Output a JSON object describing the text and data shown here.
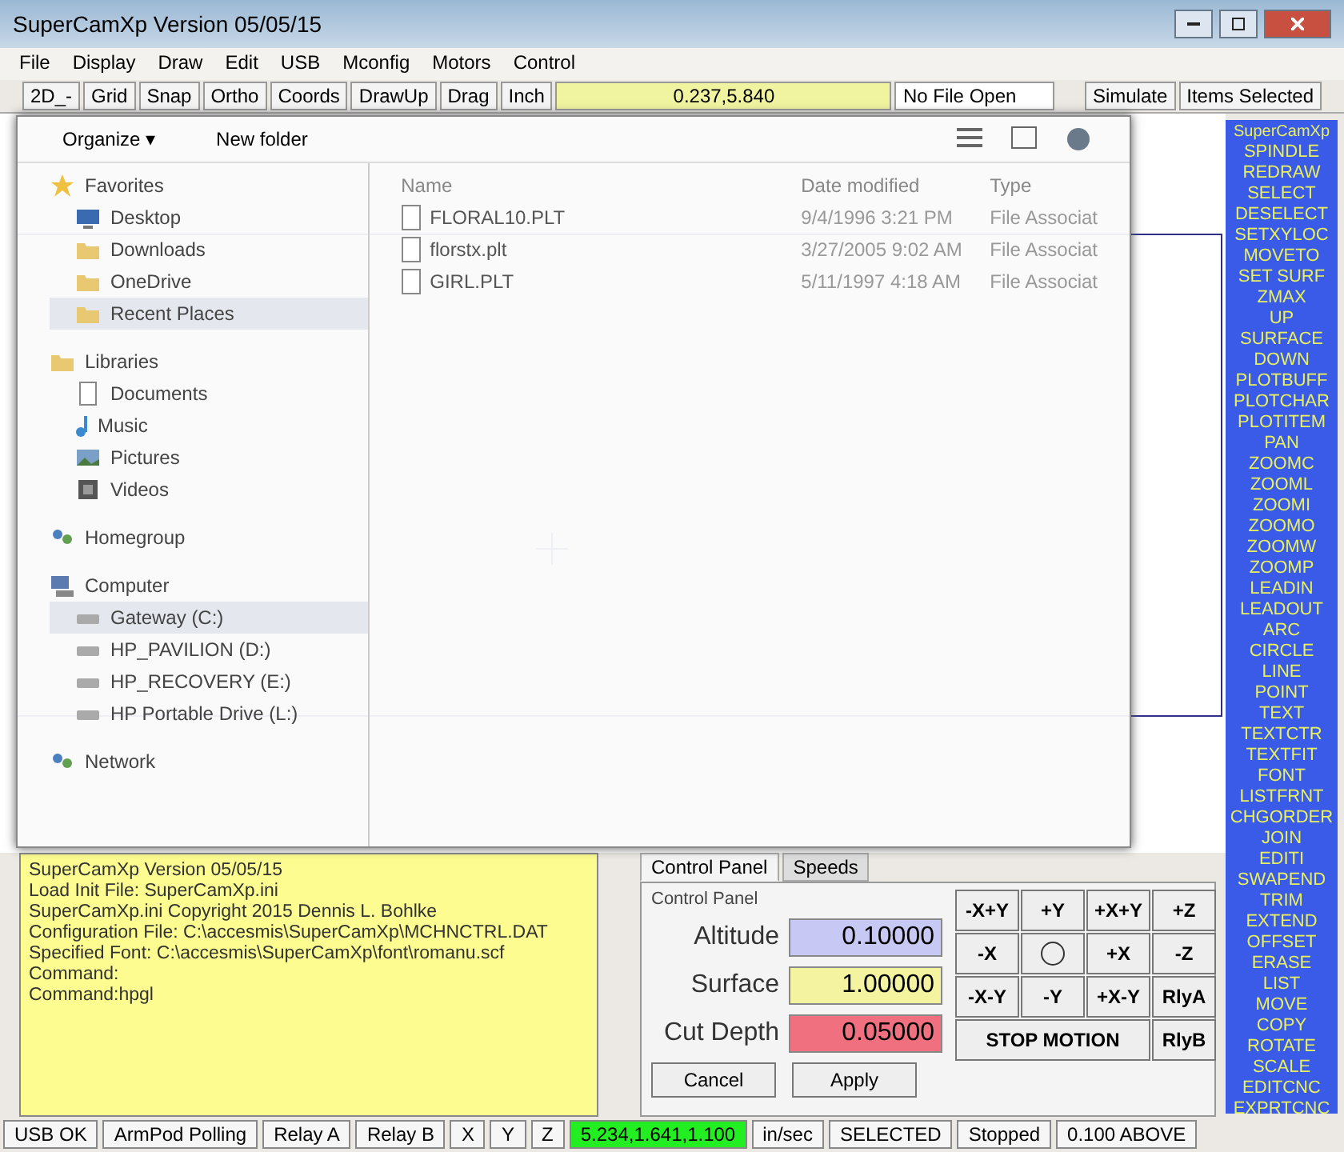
{
  "window": {
    "title": "SuperCamXp Version 05/05/15"
  },
  "menu": [
    "File",
    "Display",
    "Draw",
    "Edit",
    "USB",
    "Mconfig",
    "Motors",
    "Control"
  ],
  "toolbar": [
    {
      "text": "2D_-",
      "kind": "button"
    },
    {
      "text": "Grid",
      "kind": "button"
    },
    {
      "text": "Snap",
      "kind": "button"
    },
    {
      "text": "Ortho",
      "kind": "button"
    },
    {
      "text": "Coords",
      "kind": "button"
    },
    {
      "text": "DrawUp",
      "kind": "button"
    },
    {
      "text": "Drag",
      "kind": "button"
    },
    {
      "text": "Inch",
      "kind": "button"
    },
    {
      "text": "0.237,5.840",
      "kind": "readout"
    },
    {
      "text": "No File Open",
      "kind": "field"
    }
  ],
  "toolbar_right": [
    "Simulate",
    "Items Selected"
  ],
  "dialog": {
    "toolbar": {
      "organize": "Organize ▾",
      "new_folder": "New folder"
    },
    "nav": [
      {
        "label": "Favorites",
        "kind": "star",
        "selected": false,
        "children": [
          {
            "label": "Desktop",
            "kind": "desktop",
            "selected": false
          },
          {
            "label": "Downloads",
            "kind": "folder",
            "selected": false
          },
          {
            "label": "OneDrive",
            "kind": "folder",
            "selected": false
          },
          {
            "label": "Recent Places",
            "kind": "folder",
            "selected": true
          }
        ]
      },
      {
        "label": "Libraries",
        "kind": "folder",
        "selected": false,
        "children": [
          {
            "label": "Documents",
            "kind": "document",
            "selected": false
          },
          {
            "label": "Music",
            "kind": "music",
            "selected": false
          },
          {
            "label": "Pictures",
            "kind": "picture",
            "selected": false
          },
          {
            "label": "Videos",
            "kind": "video",
            "selected": false
          }
        ]
      },
      {
        "label": "Homegroup",
        "kind": "group",
        "selected": false
      },
      {
        "label": "Computer",
        "kind": "computer",
        "selected": false,
        "children": [
          {
            "label": "Gateway (C:)",
            "kind": "drive",
            "selected": true
          },
          {
            "label": "HP_PAVILION (D:)",
            "kind": "drive",
            "selected": false
          },
          {
            "label": "HP_RECOVERY (E:)",
            "kind": "drive",
            "selected": false
          },
          {
            "label": "HP Portable Drive (L:)",
            "kind": "drive",
            "selected": false
          }
        ]
      },
      {
        "label": "Network",
        "kind": "group",
        "selected": false
      }
    ],
    "columns": [
      "Name",
      "Date modified",
      "Type"
    ],
    "files": [
      {
        "name": "FLORAL10.PLT",
        "date": "9/4/1996 3:21 PM",
        "type": "File Associat"
      },
      {
        "name": "florstx.plt",
        "date": "3/27/2005 9:02 AM",
        "type": "File Associat"
      },
      {
        "name": "GIRL.PLT",
        "date": "5/11/1997 4:18 AM",
        "type": "File Associat"
      }
    ]
  },
  "commands": [
    "SuperCamXp",
    "SPINDLE",
    "REDRAW",
    "SELECT",
    "DESELECT",
    "SETXYLOC",
    "MOVETO",
    "SET SURF",
    "ZMAX",
    "UP",
    "SURFACE",
    "DOWN",
    "PLOTBUFF",
    "PLOTCHAR",
    "PLOTITEM",
    "PAN",
    "ZOOMC",
    "ZOOML",
    "ZOOMI",
    "ZOOMO",
    "ZOOMW",
    "ZOOMP",
    "LEADIN",
    "LEADOUT",
    "ARC",
    "CIRCLE",
    "LINE",
    "POINT",
    "TEXT",
    "TEXTCTR",
    "TEXTFIT",
    "FONT",
    "LISTFRNT",
    "CHGORDER",
    "JOIN",
    "EDITI",
    "SWAPEND",
    "TRIM",
    "EXTEND",
    "OFFSET",
    "ERASE",
    "LIST",
    "MOVE",
    "COPY",
    "ROTATE",
    "SCALE",
    "EDITCNC",
    "EXPRTCNC"
  ],
  "console": [
    "SuperCamXp Version 05/05/15",
    "Load Init File: SuperCamXp.ini",
    "SuperCamXp.ini Copyright 2015 Dennis L. Bohlke",
    "Configuration File: C:\\accesmis\\SuperCamXp\\MCHNCTRL.DAT",
    "Specified Font: C:\\accesmis\\SuperCamXp\\font\\romanu.scf",
    "Command:",
    "Command:hpgl"
  ],
  "panel": {
    "tabs": [
      {
        "label": "Control Panel",
        "selected": true
      },
      {
        "label": "Speeds",
        "selected": false
      }
    ],
    "group": "Control Panel",
    "fields": [
      {
        "label": "Altitude",
        "value": "0.10000",
        "color": "#c8c8f4"
      },
      {
        "label": "Surface",
        "value": "1.00000",
        "color": "#f4f4a0"
      },
      {
        "label": "Cut Depth",
        "value": "0.05000",
        "color": "#f07080"
      }
    ],
    "buttons": [
      "Cancel",
      "Apply"
    ],
    "jog": [
      {
        "text": "-X+Y",
        "kind": "key"
      },
      {
        "text": "+Y",
        "kind": "key"
      },
      {
        "text": "+X+Y",
        "kind": "key"
      },
      {
        "text": "+Z",
        "kind": "key"
      },
      {
        "text": "-X",
        "kind": "key"
      },
      {
        "kind": "home"
      },
      {
        "text": "+X",
        "kind": "key"
      },
      {
        "text": "-Z",
        "kind": "key"
      },
      {
        "text": "-X-Y",
        "kind": "key"
      },
      {
        "text": "-Y",
        "kind": "key"
      },
      {
        "text": "+X-Y",
        "kind": "key"
      },
      {
        "text": "RlyA",
        "kind": "key"
      },
      {
        "text": "STOP MOTION",
        "kind": "wide"
      },
      {
        "text": "RlyB",
        "kind": "key"
      }
    ]
  },
  "status": [
    {
      "text": "USB OK"
    },
    {
      "text": "ArmPod Polling"
    },
    {
      "text": "Relay A"
    },
    {
      "text": "Relay B"
    },
    {
      "text": "X"
    },
    {
      "text": "Y"
    },
    {
      "text": "Z"
    },
    {
      "text": "5.234,1.641,1.100",
      "color": "#22ee22"
    },
    {
      "text": "in/sec"
    },
    {
      "text": "SELECTED"
    },
    {
      "text": "Stopped"
    },
    {
      "text": "0.100 ABOVE"
    }
  ]
}
